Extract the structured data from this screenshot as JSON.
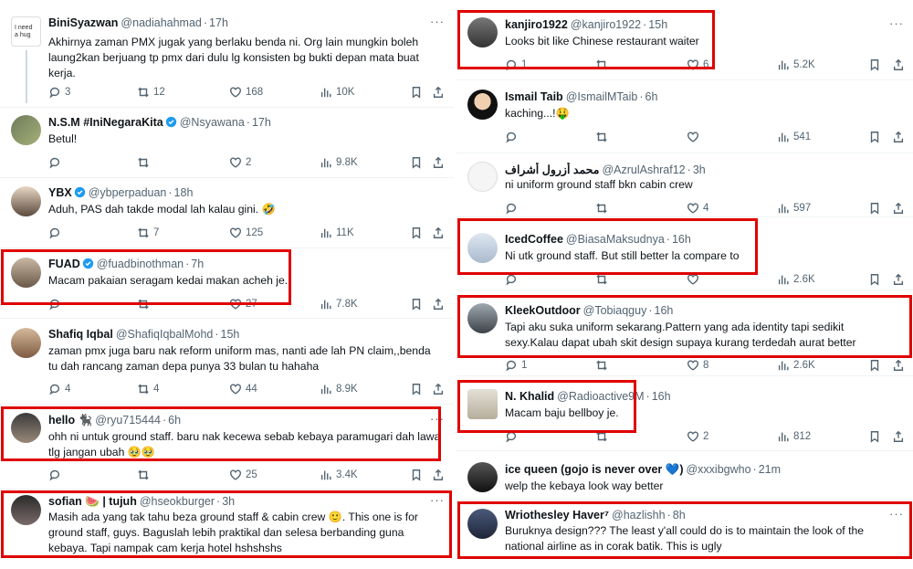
{
  "left": [
    {
      "name": "BiniSyazwan",
      "handle": "@nadiahahmad",
      "time": "17h",
      "verified": false,
      "text": "Akhirnya zaman PMX jugak yang berlaku benda ni. Org lain mungkin boleh laung2kan berjuang tp pmx dari dulu lg konsisten bg bukti depan mata buat kerja.",
      "avatar_text": "I need a hug",
      "reply": "3",
      "retweet": "12",
      "like": "168",
      "views": "10K"
    },
    {
      "name": "N.S.M #IniNegaraKita",
      "handle": "@Nsyawana",
      "time": "17h",
      "verified": true,
      "text": "Betul!",
      "reply": "",
      "retweet": "",
      "like": "2",
      "views": "9.8K"
    },
    {
      "name": "YBX",
      "handle": "@ybperpaduan",
      "time": "18h",
      "verified": true,
      "text": "Aduh, PAS dah takde modal lah kalau gini. 🤣",
      "reply": "",
      "retweet": "7",
      "like": "125",
      "views": "11K"
    },
    {
      "name": "FUAD",
      "handle": "@fuadbinothman",
      "time": "7h",
      "verified": true,
      "text": "Macam pakaian seragam kedai makan acheh je.",
      "reply": "",
      "retweet": "",
      "like": "27",
      "views": "7.8K"
    },
    {
      "name": "Shafiq Iqbal",
      "handle": "@ShafiqIqbalMohd",
      "time": "15h",
      "verified": false,
      "text": "zaman pmx juga baru nak reform uniform mas, nanti ade lah PN claim,,benda tu dah rancang zaman depa punya 33 bulan tu hahaha",
      "reply": "4",
      "retweet": "4",
      "like": "44",
      "views": "8.9K"
    },
    {
      "name": "hello 🐈‍⬛",
      "handle": "@ryu715444",
      "time": "6h",
      "verified": false,
      "text": "ohh ni untuk ground staff. baru nak kecewa sebab kebaya paramugari dah lawa tlg jangan ubah 🥹🥹",
      "reply": "",
      "retweet": "",
      "like": "25",
      "views": "3.4K"
    },
    {
      "name": "sofian 🍉 | tujuh",
      "handle": "@hseokburger",
      "time": "3h",
      "verified": false,
      "text": "Masih ada yang tak tahu beza ground staff & cabin crew 🙂. This one is for ground staff, guys. Baguslah lebih praktikal dan selesa berbanding guna kebaya. Tapi nampak cam kerja hotel hshshshs"
    }
  ],
  "right": [
    {
      "name": "kanjiro1922",
      "handle": "@kanjiro1922",
      "time": "15h",
      "verified": false,
      "text": "Looks bit like Chinese restaurant waiter",
      "reply": "1",
      "retweet": "",
      "like": "6",
      "views": "5.2K"
    },
    {
      "name": "Ismail Taib",
      "handle": "@IsmailMTaib",
      "time": "6h",
      "verified": false,
      "text": "kaching...!🤑",
      "reply": "",
      "retweet": "",
      "like": "",
      "views": "541"
    },
    {
      "name": "محمد أزرول أشراف",
      "handle": "@AzrulAshraf12",
      "time": "3h",
      "verified": false,
      "text": "ni uniform ground staff bkn cabin crew",
      "reply": "",
      "retweet": "",
      "like": "4",
      "views": "597"
    },
    {
      "name": "IcedCoffee",
      "handle": "@BiasaMaksudnya",
      "time": "16h",
      "verified": false,
      "text": "Ni utk ground staff. But still better la compare to",
      "reply": "",
      "retweet": "",
      "like": "",
      "views": "2.6K"
    },
    {
      "name": "KleekOutdoor",
      "handle": "@Tobiaqguy",
      "time": "16h",
      "verified": false,
      "text": "Tapi aku suka uniform sekarang.Pattern yang ada identity tapi sedikit sexy.Kalau dapat ubah skit design supaya kurang terdedah aurat better",
      "reply": "1",
      "retweet": "",
      "like": "8",
      "views": "2.6K"
    },
    {
      "name": "N. Khalid",
      "handle": "@Radioactive9M",
      "time": "16h",
      "verified": false,
      "text": "Macam baju bellboy je.",
      "reply": "",
      "retweet": "",
      "like": "2",
      "views": "812"
    },
    {
      "name": "ice queen (gojo is never over 💙)",
      "handle": "@xxxibgwho",
      "time": "21m",
      "verified": false,
      "text": "welp the kebaya look way better"
    },
    {
      "name": "Wriothesley Haver⁷",
      "handle": "@hazlishh",
      "time": "8h",
      "verified": false,
      "text": "Buruknya design??? The least y'all could do is to maintain the look of the national airline as in corak batik. This is ugly"
    }
  ]
}
